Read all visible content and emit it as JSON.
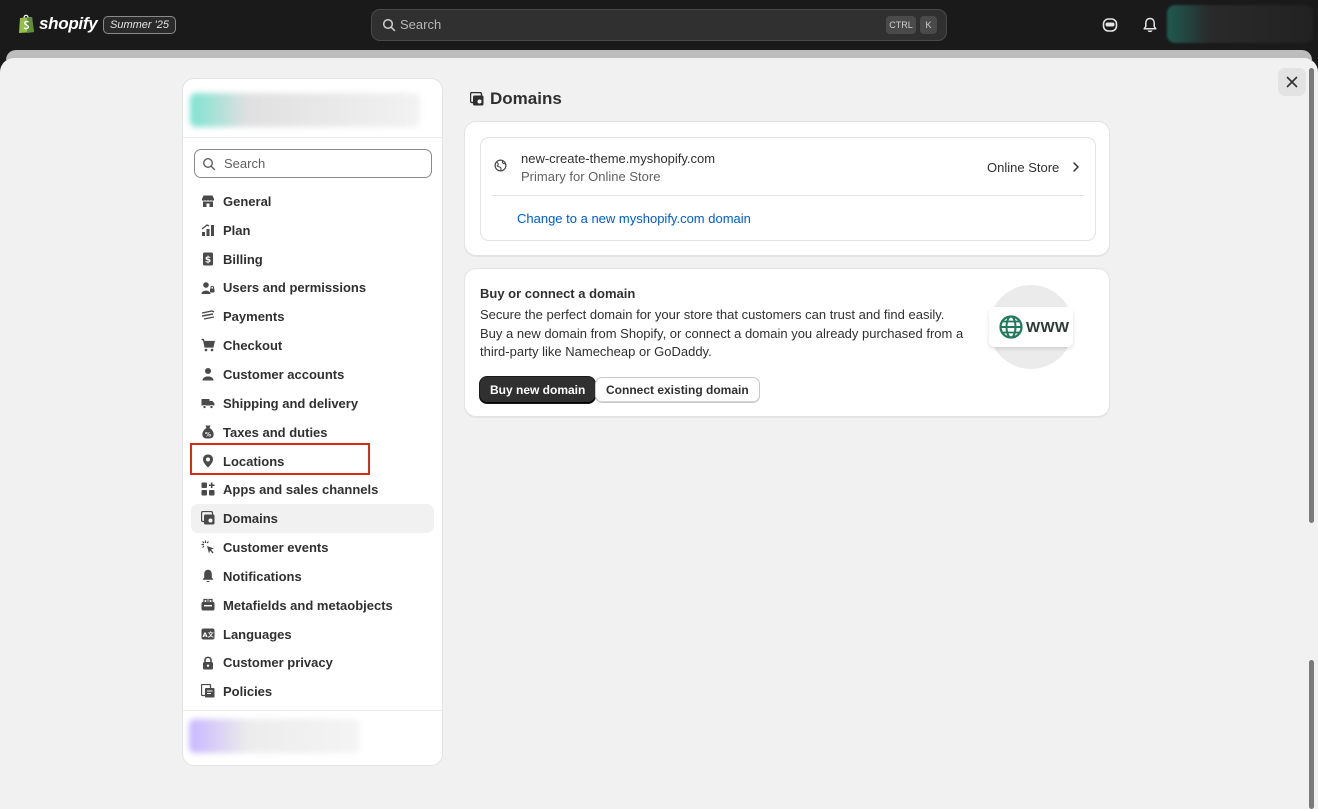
{
  "topbar": {
    "brand": "shopify",
    "edition": "Summer '25",
    "search_placeholder": "Search",
    "kbd_ctrl": "CTRL",
    "kbd_k": "K"
  },
  "sidebar": {
    "search_placeholder": "Search",
    "items": [
      {
        "label": "General",
        "icon": "store-icon"
      },
      {
        "label": "Plan",
        "icon": "plan-icon"
      },
      {
        "label": "Billing",
        "icon": "billing-icon"
      },
      {
        "label": "Users and permissions",
        "icon": "users-icon"
      },
      {
        "label": "Payments",
        "icon": "payments-icon"
      },
      {
        "label": "Checkout",
        "icon": "cart-icon"
      },
      {
        "label": "Customer accounts",
        "icon": "person-icon"
      },
      {
        "label": "Shipping and delivery",
        "icon": "truck-icon"
      },
      {
        "label": "Taxes and duties",
        "icon": "taxes-icon"
      },
      {
        "label": "Locations",
        "icon": "location-icon"
      },
      {
        "label": "Apps and sales channels",
        "icon": "apps-icon"
      },
      {
        "label": "Domains",
        "icon": "domains-icon",
        "active": true
      },
      {
        "label": "Customer events",
        "icon": "cursor-icon"
      },
      {
        "label": "Notifications",
        "icon": "bell-icon"
      },
      {
        "label": "Metafields and metaobjects",
        "icon": "metafields-icon"
      },
      {
        "label": "Languages",
        "icon": "languages-icon"
      },
      {
        "label": "Customer privacy",
        "icon": "lock-icon"
      },
      {
        "label": "Policies",
        "icon": "policies-icon"
      }
    ]
  },
  "main": {
    "title": "Domains",
    "primary_domain": {
      "name": "new-create-theme.myshopify.com",
      "subtitle": "Primary for Online Store",
      "channel": "Online Store",
      "change_link": "Change to a new myshopify.com domain"
    },
    "connect_card": {
      "title": "Buy or connect a domain",
      "body": "Secure the perfect domain for your store that customers can trust and find easily. Buy a new domain from Shopify, or connect a domain you already purchased from a third-party like Namecheap or GoDaddy.",
      "buy_button": "Buy new domain",
      "connect_button": "Connect existing domain",
      "illustration_text": "WWW"
    }
  },
  "colors": {
    "accent_link": "#005bd3",
    "primary_button": "#303030",
    "highlight": "#d72c0d"
  }
}
